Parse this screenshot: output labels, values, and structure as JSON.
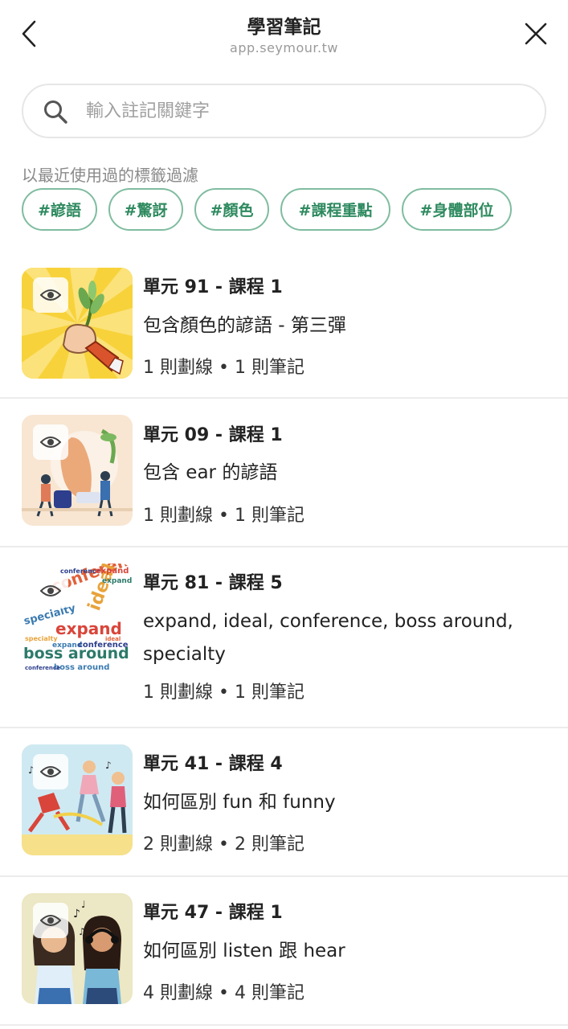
{
  "header": {
    "title": "學習筆記",
    "subtitle": "app.seymour.tw"
  },
  "search": {
    "placeholder": "輸入註記關鍵字",
    "value": ""
  },
  "filter": {
    "label": "以最近使用過的標籤過濾",
    "tags": [
      "#諺語",
      "#驚訝",
      "#顏色",
      "#課程重點",
      "#身體部位"
    ]
  },
  "notes": [
    {
      "title": "單元 91 - 課程 1",
      "description": "包含顏色的諺語 - 第三彈",
      "meta": "1 則劃線 • 1 則筆記"
    },
    {
      "title": "單元 09 - 課程 1",
      "description": "包含 ear 的諺語",
      "meta": "1 則劃線 • 1 則筆記"
    },
    {
      "title": "單元 81 - 課程 5",
      "description": "expand, ideal, conference, boss around, specialty",
      "meta": "1 則劃線 • 1 則筆記"
    },
    {
      "title": "單元 41 - 課程 4",
      "description": "如何區別 fun 和 funny",
      "meta": "2 則劃線 • 2 則筆記"
    },
    {
      "title": "單元 47 - 課程 1",
      "description": "如何區別 listen 跟 hear",
      "meta": "4 則劃線 • 4 則筆記"
    }
  ],
  "thumb_words": {
    "w1": "expand",
    "w2": "ideal",
    "w3": "conference",
    "w4": "boss around",
    "w5": "specialty"
  },
  "colors": {
    "accent": "#2e8a5f",
    "tag_border": "#7fbca0",
    "muted": "#9a9a9a"
  }
}
